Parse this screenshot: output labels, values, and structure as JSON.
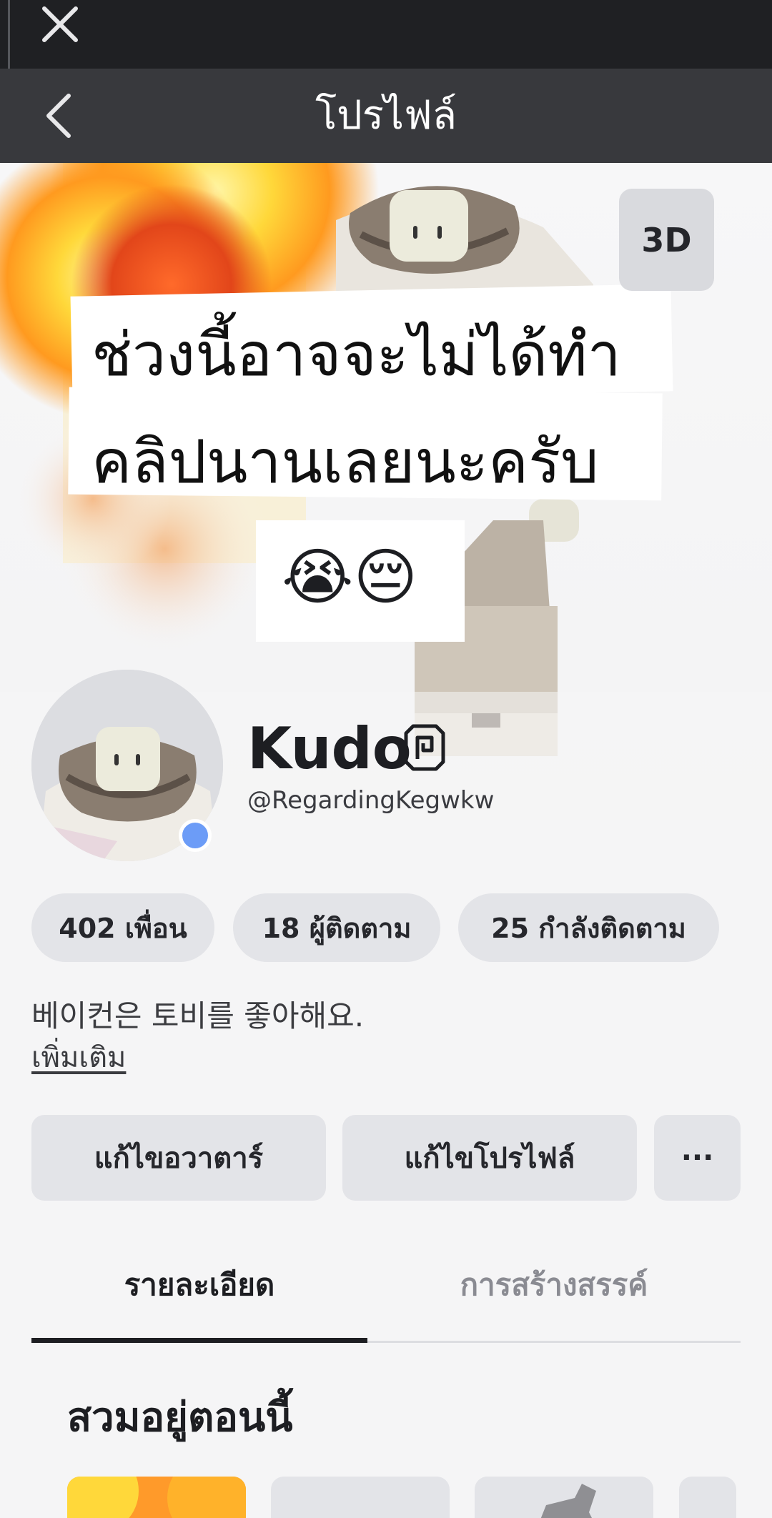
{
  "header": {
    "title": "โปรไฟล์",
    "close_icon": "close-icon",
    "back_icon": "chevron-left-icon"
  },
  "banner": {
    "view_3d_label": "3D",
    "caption_line1": "ช่วงนี้อาจจะไม่ได้ทำ",
    "caption_line2": "คลิปนานเลยนะครับ",
    "caption_emojis": "😭😔"
  },
  "profile": {
    "display_name": "Kudo",
    "username": "@RegardingKegwkw",
    "status_color": "#6c9cf7",
    "verified_icon": "premium-icon"
  },
  "stats": [
    {
      "label": "402 เพื่อน"
    },
    {
      "label": "18 ผู้ติดตาม"
    },
    {
      "label": "25 กำลังติดตาม"
    }
  ],
  "bio": {
    "text": "베이컨은 토비를 좋아해요.",
    "more_label": "เพิ่มเติม"
  },
  "actions": {
    "edit_avatar": "แก้ไขอวาตาร์",
    "edit_profile": "แก้ไขโปรไฟล์",
    "more_label": "···"
  },
  "tabs": [
    {
      "label": "รายละเอียด",
      "active": true
    },
    {
      "label": "การสร้างสรรค์",
      "active": false
    }
  ],
  "wearing": {
    "title": "สวมอยู่ตอนนี้"
  },
  "colors": {
    "topbar": "#1f2023",
    "navbar": "#38393d",
    "chip": "#e3e4e8",
    "accent_online": "#6c9cf7"
  }
}
